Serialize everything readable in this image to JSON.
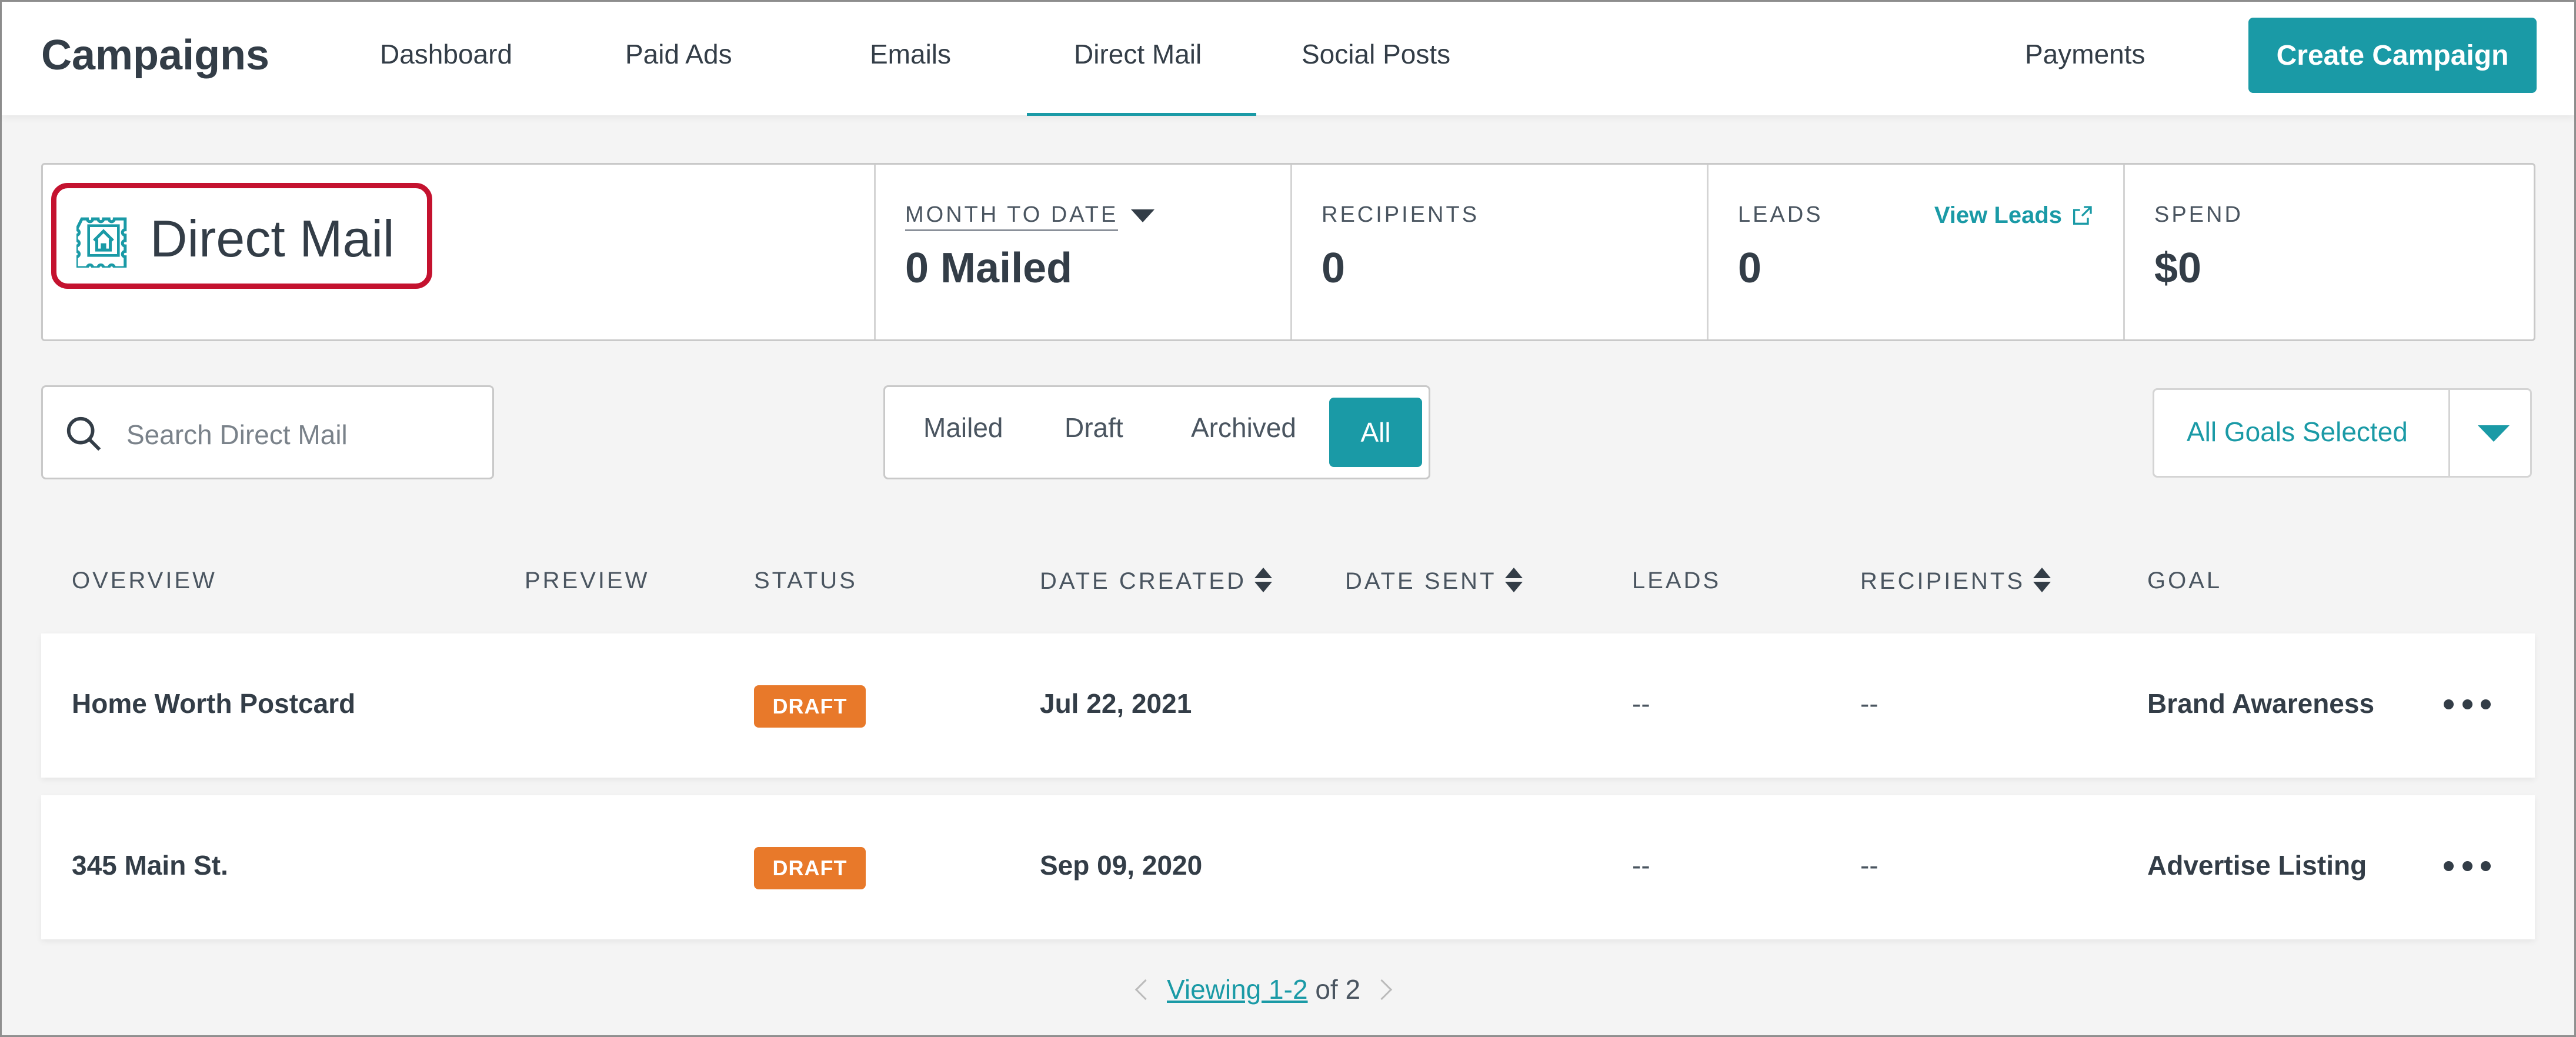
{
  "app": {
    "title": "Campaigns"
  },
  "nav": {
    "tabs": [
      {
        "label": "Dashboard"
      },
      {
        "label": "Paid Ads"
      },
      {
        "label": "Emails"
      },
      {
        "label": "Direct Mail",
        "active": true
      },
      {
        "label": "Social Posts"
      }
    ],
    "payments": "Payments",
    "create_campaign": "Create Campaign"
  },
  "header": {
    "title": "Direct Mail",
    "icon": "stamp-house-icon"
  },
  "stats": {
    "month_to_date": {
      "label": "MONTH TO DATE",
      "value": "0 Mailed"
    },
    "recipients": {
      "label": "RECIPIENTS",
      "value": "0"
    },
    "leads": {
      "label": "LEADS",
      "value": "0",
      "link": "View Leads"
    },
    "spend": {
      "label": "SPEND",
      "value": "$0"
    }
  },
  "search": {
    "placeholder": "Search Direct Mail",
    "value": ""
  },
  "filters": [
    "Mailed",
    "Draft",
    "Archived",
    "All"
  ],
  "active_filter": "All",
  "goals_select": {
    "value": "All Goals Selected"
  },
  "table": {
    "columns": [
      "OVERVIEW",
      "PREVIEW",
      "STATUS",
      "DATE CREATED",
      "DATE SENT",
      "LEADS",
      "RECIPIENTS",
      "GOAL"
    ],
    "rows": [
      {
        "overview": "Home Worth Postcard",
        "status": "DRAFT",
        "date_created": "Jul 22, 2021",
        "date_sent": "",
        "leads": "--",
        "recipients": "--",
        "goal": "Brand Awareness"
      },
      {
        "overview": "345 Main St.",
        "status": "DRAFT",
        "date_created": "Sep 09, 2020",
        "date_sent": "",
        "leads": "--",
        "recipients": "--",
        "goal": "Advertise Listing"
      }
    ]
  },
  "pagination": {
    "viewing": "Viewing 1-2",
    "of": "of 2"
  },
  "colors": {
    "accent": "#1a9aa6",
    "draft": "#e8792a",
    "highlight": "#c4122f"
  }
}
